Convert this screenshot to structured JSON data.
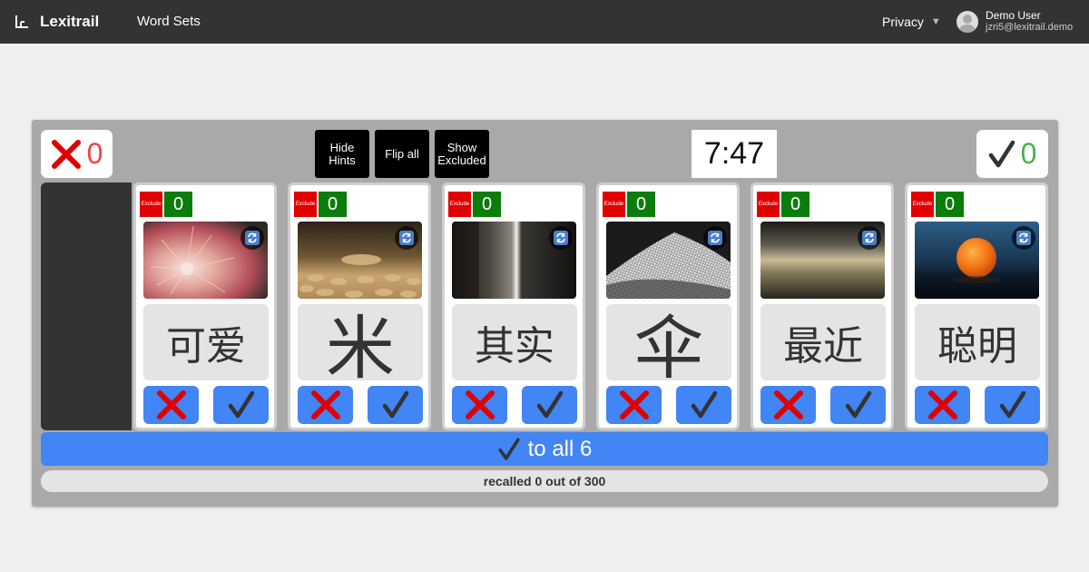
{
  "nav": {
    "brand": "Lexitrail",
    "word_sets": "Word Sets",
    "privacy": "Privacy",
    "user_name": "Demo User",
    "user_email": "jzri5@lexitrail.demo"
  },
  "game": {
    "wrong_count": "0",
    "right_count": "0",
    "hide_hints_line1": "Hide",
    "hide_hints_line2": "Hints",
    "flip_all": "Flip all",
    "show_excluded_line1": "Show",
    "show_excluded_line2": "Excluded",
    "timer": "7:47",
    "to_all_label": "to all 6",
    "progress_text": "recalled 0 out of 300",
    "progress_fraction": 0
  },
  "cards": [
    {
      "exclude_label": "Exclude",
      "count": "0",
      "word": "可爱",
      "image": "pink-fluffy-fur"
    },
    {
      "exclude_label": "Exclude",
      "count": "0",
      "word": "米",
      "image": "rice-grains-closeup"
    },
    {
      "exclude_label": "Exclude",
      "count": "0",
      "word": "其实",
      "image": "dark-light-beam"
    },
    {
      "exclude_label": "Exclude",
      "count": "0",
      "word": "伞",
      "image": "woven-fabric"
    },
    {
      "exclude_label": "Exclude",
      "count": "0",
      "word": "最近",
      "image": "blurred-road-horizon"
    },
    {
      "exclude_label": "Exclude",
      "count": "0",
      "word": "聪明",
      "image": "orange-ball-on-water"
    }
  ],
  "colors": {
    "topbar": "#333333",
    "panel": "#a9a9a9",
    "accent_blue": "#4285f4",
    "exclude_red": "#e00000",
    "count_green": "#0a7d0a",
    "wrong_red": "#e84545",
    "right_green": "#4caf50"
  }
}
